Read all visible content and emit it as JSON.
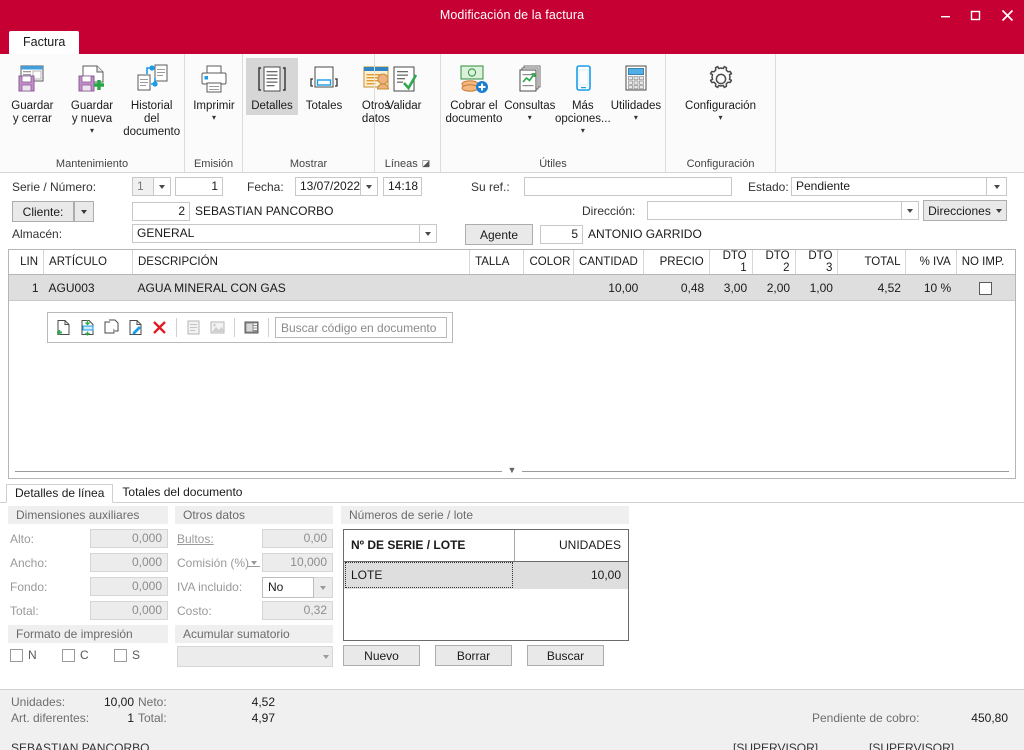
{
  "window": {
    "title": "Modificación de la factura",
    "minimize_label": "minimize-icon",
    "maximize_label": "maximize-icon",
    "close_label": "close-icon",
    "accent_color": "#c60033"
  },
  "ribbon": {
    "tab_label": "Factura",
    "groups": [
      {
        "name": "Mantenimiento",
        "label": "Mantenimiento",
        "buttons": [
          {
            "label": "Guardar\ny cerrar",
            "icon": "save-close-icon",
            "caret": false
          },
          {
            "label": "Guardar\ny nueva",
            "icon": "save-new-icon",
            "caret": true
          },
          {
            "label": "Historial del\ndocumento",
            "icon": "history-icon",
            "caret": false
          }
        ]
      },
      {
        "name": "Emisión",
        "label": "Emisión",
        "buttons": [
          {
            "label": "Imprimir",
            "icon": "printer-icon",
            "caret": true
          }
        ]
      },
      {
        "name": "Mostrar",
        "label": "Mostrar",
        "buttons": [
          {
            "label": "Detalles",
            "icon": "details-icon",
            "caret": false,
            "active": true
          },
          {
            "label": "Totales",
            "icon": "totals-icon",
            "caret": false
          },
          {
            "label": "Otros\ndatos",
            "icon": "other-data-icon",
            "caret": false
          }
        ]
      },
      {
        "name": "Líneas",
        "label": "Líneas",
        "launcher": true,
        "buttons": [
          {
            "label": "Validar",
            "icon": "validate-icon",
            "caret": false
          }
        ]
      },
      {
        "name": "Útiles",
        "label": "Útiles",
        "buttons": [
          {
            "label": "Cobrar el\ndocumento",
            "icon": "collect-money-icon",
            "caret": false
          },
          {
            "label": "Consultas",
            "icon": "queries-icon",
            "caret": true
          },
          {
            "label": "Más\nopciones...",
            "icon": "more-options-icon",
            "caret": true
          },
          {
            "label": "Utilidades",
            "icon": "utilities-icon",
            "caret": true
          }
        ]
      },
      {
        "name": "Configuración",
        "label": "Configuración",
        "buttons": [
          {
            "label": "Configuración",
            "icon": "gear-icon",
            "caret": true
          }
        ]
      }
    ]
  },
  "header_form": {
    "serie_numero_label": "Serie / Número:",
    "serie_value": "1",
    "numero_value": "1",
    "fecha_label": "Fecha:",
    "fecha_value": "13/07/2022",
    "hora_value": "14:18",
    "su_ref_label": "Su ref.:",
    "su_ref_value": "",
    "estado_label": "Estado:",
    "estado_value": "Pendiente",
    "cliente_label": "Cliente:",
    "cliente_code": "2",
    "cliente_name": "SEBASTIAN PANCORBO",
    "direccion_label": "Dirección:",
    "direccion_value": "",
    "direcciones_button": "Direcciones",
    "almacen_label": "Almacén:",
    "almacen_value": "GENERAL",
    "agente_button": "Agente",
    "agente_code": "5",
    "agente_name": "ANTONIO GARRIDO"
  },
  "grid": {
    "columns": [
      {
        "key": "lin",
        "label": "LIN",
        "align": "right"
      },
      {
        "key": "articulo",
        "label": "ARTÍCULO",
        "align": "left"
      },
      {
        "key": "descripcion",
        "label": "DESCRIPCIÓN",
        "align": "left"
      },
      {
        "key": "talla",
        "label": "TALLA",
        "align": "left"
      },
      {
        "key": "color",
        "label": "COLOR",
        "align": "left"
      },
      {
        "key": "cantidad",
        "label": "CANTIDAD",
        "align": "right"
      },
      {
        "key": "precio",
        "label": "PRECIO",
        "align": "right"
      },
      {
        "key": "dto1",
        "label": "DTO 1",
        "align": "right"
      },
      {
        "key": "dto2",
        "label": "DTO 2",
        "align": "right"
      },
      {
        "key": "dto3",
        "label": "DTO 3",
        "align": "right"
      },
      {
        "key": "total",
        "label": "TOTAL",
        "align": "right"
      },
      {
        "key": "iva",
        "label": "% IVA",
        "align": "right"
      },
      {
        "key": "noimp",
        "label": "NO IMP.",
        "align": "center"
      }
    ],
    "rows": [
      {
        "lin": "1",
        "articulo": "AGU003",
        "descripcion": "AGUA MINERAL CON GAS",
        "talla": "",
        "color": "",
        "cantidad": "10,00",
        "precio": "0,48",
        "dto1": "3,00",
        "dto2": "2,00",
        "dto3": "1,00",
        "total": "4,52",
        "iva": "10 %",
        "noimp_checked": false
      }
    ],
    "line_toolbar": {
      "icons": [
        "new-line-icon",
        "insert-line-icon",
        "copy-line-icon",
        "edit-line-icon",
        "delete-line-icon",
        "notes-icon",
        "image-icon",
        "columns-icon"
      ],
      "search_placeholder": "Buscar código en documento"
    }
  },
  "bottom_tabs": [
    {
      "label": "Detalles de línea",
      "active": true
    },
    {
      "label": "Totales del documento",
      "active": false
    }
  ],
  "detail_panels": {
    "dimensiones": {
      "title": "Dimensiones auxiliares",
      "fields": [
        {
          "label": "Alto:",
          "value": "0,000"
        },
        {
          "label": "Ancho:",
          "value": "0,000"
        },
        {
          "label": "Fondo:",
          "value": "0,000"
        },
        {
          "label": "Total:",
          "value": "0,000"
        }
      ]
    },
    "formato": {
      "title": "Formato de impresión",
      "checks": [
        {
          "label": "N",
          "checked": false
        },
        {
          "label": "C",
          "checked": false
        },
        {
          "label": "S",
          "checked": false
        }
      ]
    },
    "otros": {
      "title": "Otros datos",
      "fields": [
        {
          "label": "Bultos:",
          "value": "0,00"
        },
        {
          "label": "Comisión (%)",
          "value": "10,000"
        },
        {
          "label": "IVA incluido:",
          "value": "No"
        },
        {
          "label": "Costo:",
          "value": "0,32"
        }
      ]
    },
    "acumular": {
      "title": "Acumular sumatorio",
      "value": ""
    },
    "series": {
      "title": "Números de serie / lote",
      "columns": [
        "Nº DE SERIE / LOTE",
        "UNIDADES"
      ],
      "rows": [
        {
          "serie": "LOTE",
          "unidades": "10,00"
        }
      ],
      "buttons": [
        "Nuevo",
        "Borrar",
        "Buscar"
      ]
    }
  },
  "status": {
    "unidades_label": "Unidades:",
    "unidades_value": "10,00",
    "neto_label": "Neto:",
    "neto_value": "4,52",
    "art_dif_label": "Art. diferentes:",
    "art_dif_value": "1",
    "total_label": "Total:",
    "total_value": "4,97",
    "pendiente_label": "Pendiente de cobro:",
    "pendiente_value": "450,80"
  },
  "footer": {
    "user": "SEBASTIAN PANCORBO",
    "role_1": "[SUPERVISOR]",
    "role_2": "[SUPERVISOR]"
  }
}
